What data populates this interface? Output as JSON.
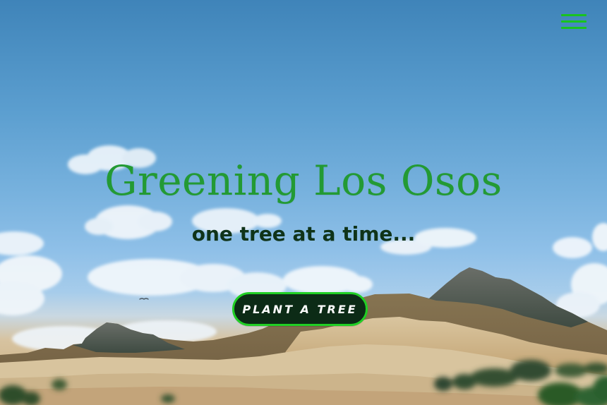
{
  "hero": {
    "title": "Greening Los Osos",
    "subtitle": "one tree at a time...",
    "cta_label": "PLANT A TREE"
  },
  "navigation": {
    "menu_icon": "hamburger-menu-icon"
  },
  "colors": {
    "title_green": "#239a34",
    "subtitle_dark_green": "#0f3319",
    "button_bg": "#0c2b16",
    "button_border": "#20cf24",
    "menu_green": "#19c31f"
  }
}
